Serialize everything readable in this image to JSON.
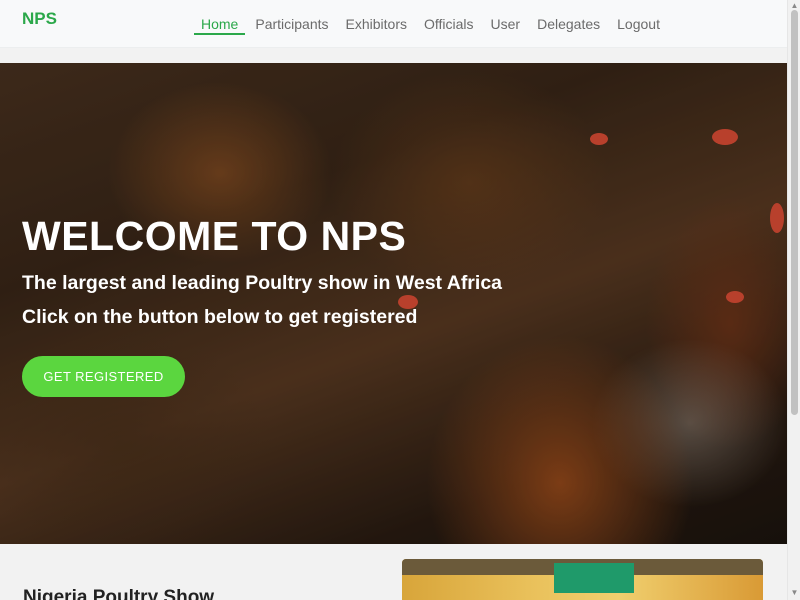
{
  "brand": "NPS",
  "nav": {
    "items": [
      {
        "label": "Home",
        "active": true
      },
      {
        "label": "Participants"
      },
      {
        "label": "Exhibitors"
      },
      {
        "label": "Officials"
      },
      {
        "label": "User"
      },
      {
        "label": "Delegates"
      },
      {
        "label": "Logout"
      }
    ]
  },
  "hero": {
    "title": "WELCOME TO NPS",
    "subtitle1": "The largest and leading Poultry show in West Africa",
    "subtitle2": "Click on the button below to get registered",
    "cta_label": "GET REGISTERED",
    "background_icon": "hens-photo"
  },
  "section": {
    "title": "Nigeria Poultry Show"
  },
  "colors": {
    "brand": "#2ba84a",
    "cta": "#5bd63f"
  }
}
